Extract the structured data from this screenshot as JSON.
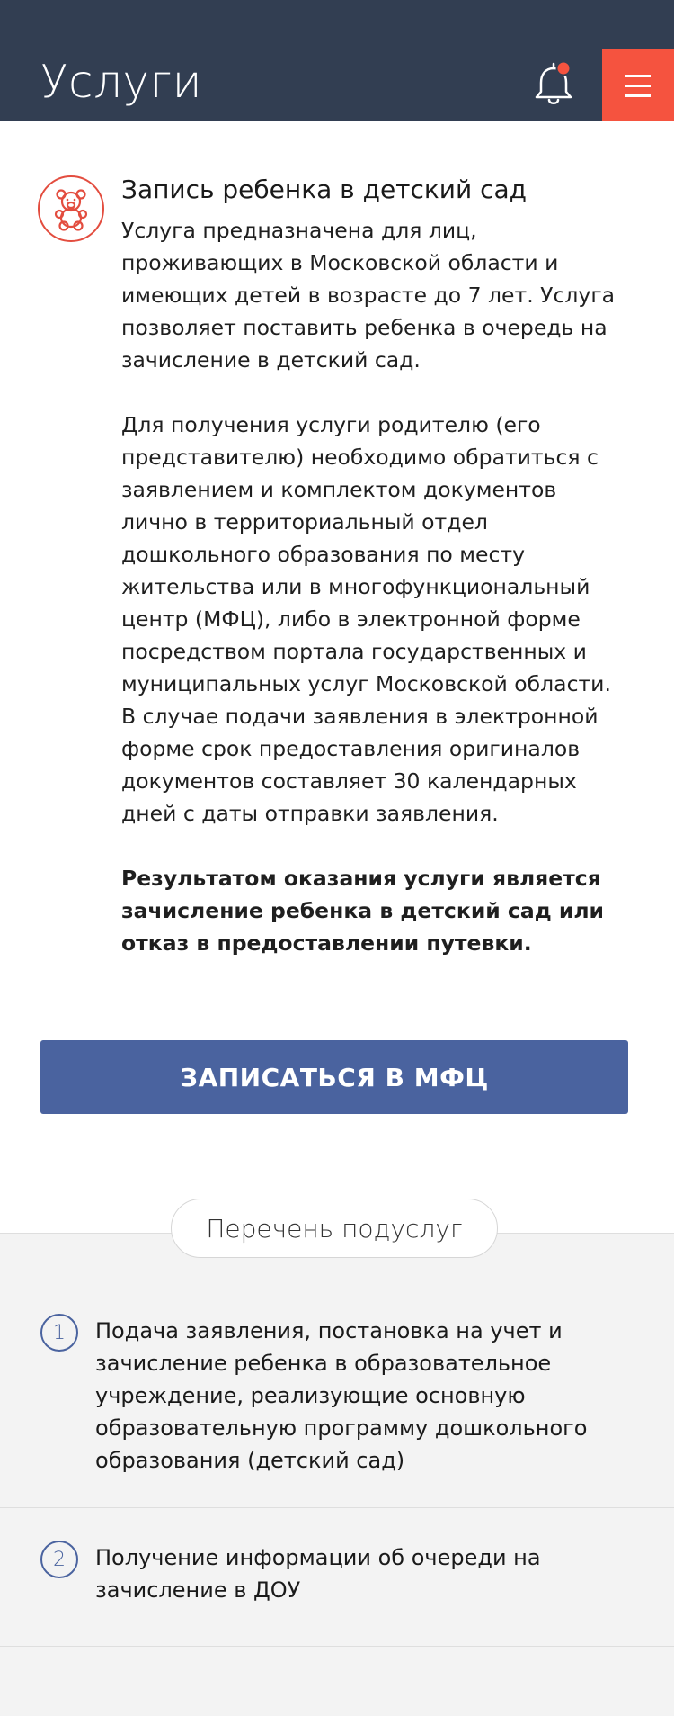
{
  "header": {
    "title": "Услуги",
    "bell_icon": "bell-icon",
    "menu_icon": "hamburger-menu-icon",
    "notification_color": "#f5533f",
    "background": "#323e52"
  },
  "service": {
    "icon": "teddy-bear-icon",
    "title": "Запись ребенка в детский сад",
    "paragraphs": {
      "p1": "Услуга предназначена для лиц, проживающих в Московской области и имеющих детей в возрасте до 7 лет. Услуга позволяет поставить ребенка в очередь на зачисление в детский сад.",
      "p2": "Для получения услуги родителю (его представителю) необходимо обратиться с заявлением и комплектом документов лично в территориальный отдел дошкольного образования по месту жительства или в многофункциональный центр (МФЦ), либо в электронной форме посредством портала государственных и муниципальных услуг Московской области. В случае подачи заявления в электронной форме срок предоставления оригиналов документов составляет 30 календарных дней с даты отправки заявления.",
      "p3": "Результатом оказания услуги является зачисление ребенка в детский сад или отказ в предоставлении путевки."
    }
  },
  "actions": {
    "mfc_button": "ЗАПИСАТЬСЯ В МФЦ",
    "mfc_color": "#4a639f"
  },
  "subservices": {
    "heading": "Перечень подуслуг",
    "items": [
      {
        "number": "1",
        "text": "Подача заявления, постановка на учет и зачисление ребенка в образовательное учреждение, реализующие основную образовательную программу дошкольного образования (детский сад)"
      },
      {
        "number": "2",
        "text": "Получение информации об очереди на зачисление в ДОУ"
      }
    ]
  }
}
